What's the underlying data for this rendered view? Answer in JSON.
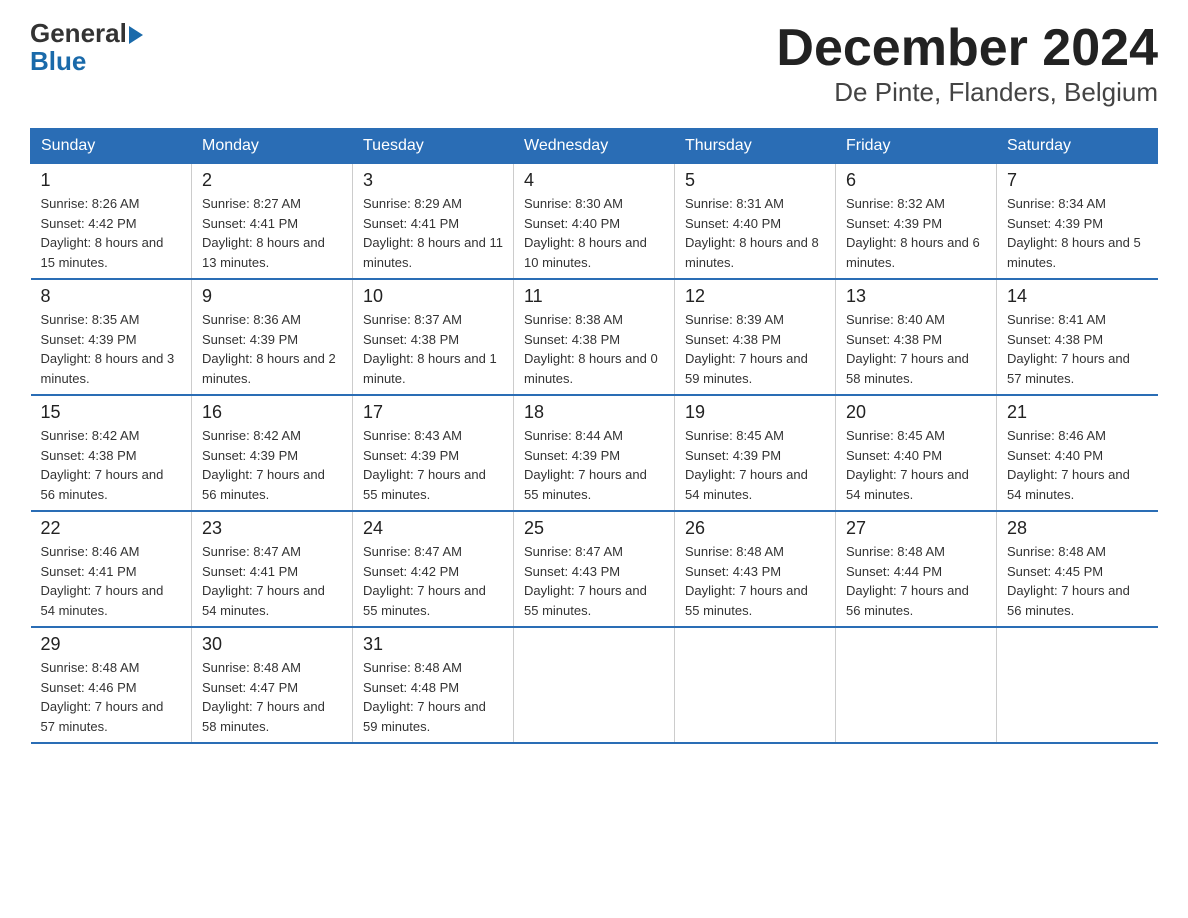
{
  "header": {
    "logo_line1": "General",
    "logo_line2": "Blue",
    "title": "December 2024",
    "subtitle": "De Pinte, Flanders, Belgium"
  },
  "columns": [
    "Sunday",
    "Monday",
    "Tuesday",
    "Wednesday",
    "Thursday",
    "Friday",
    "Saturday"
  ],
  "weeks": [
    [
      {
        "day": "1",
        "sunrise": "8:26 AM",
        "sunset": "4:42 PM",
        "daylight": "8 hours and 15 minutes."
      },
      {
        "day": "2",
        "sunrise": "8:27 AM",
        "sunset": "4:41 PM",
        "daylight": "8 hours and 13 minutes."
      },
      {
        "day": "3",
        "sunrise": "8:29 AM",
        "sunset": "4:41 PM",
        "daylight": "8 hours and 11 minutes."
      },
      {
        "day": "4",
        "sunrise": "8:30 AM",
        "sunset": "4:40 PM",
        "daylight": "8 hours and 10 minutes."
      },
      {
        "day": "5",
        "sunrise": "8:31 AM",
        "sunset": "4:40 PM",
        "daylight": "8 hours and 8 minutes."
      },
      {
        "day": "6",
        "sunrise": "8:32 AM",
        "sunset": "4:39 PM",
        "daylight": "8 hours and 6 minutes."
      },
      {
        "day": "7",
        "sunrise": "8:34 AM",
        "sunset": "4:39 PM",
        "daylight": "8 hours and 5 minutes."
      }
    ],
    [
      {
        "day": "8",
        "sunrise": "8:35 AM",
        "sunset": "4:39 PM",
        "daylight": "8 hours and 3 minutes."
      },
      {
        "day": "9",
        "sunrise": "8:36 AM",
        "sunset": "4:39 PM",
        "daylight": "8 hours and 2 minutes."
      },
      {
        "day": "10",
        "sunrise": "8:37 AM",
        "sunset": "4:38 PM",
        "daylight": "8 hours and 1 minute."
      },
      {
        "day": "11",
        "sunrise": "8:38 AM",
        "sunset": "4:38 PM",
        "daylight": "8 hours and 0 minutes."
      },
      {
        "day": "12",
        "sunrise": "8:39 AM",
        "sunset": "4:38 PM",
        "daylight": "7 hours and 59 minutes."
      },
      {
        "day": "13",
        "sunrise": "8:40 AM",
        "sunset": "4:38 PM",
        "daylight": "7 hours and 58 minutes."
      },
      {
        "day": "14",
        "sunrise": "8:41 AM",
        "sunset": "4:38 PM",
        "daylight": "7 hours and 57 minutes."
      }
    ],
    [
      {
        "day": "15",
        "sunrise": "8:42 AM",
        "sunset": "4:38 PM",
        "daylight": "7 hours and 56 minutes."
      },
      {
        "day": "16",
        "sunrise": "8:42 AM",
        "sunset": "4:39 PM",
        "daylight": "7 hours and 56 minutes."
      },
      {
        "day": "17",
        "sunrise": "8:43 AM",
        "sunset": "4:39 PM",
        "daylight": "7 hours and 55 minutes."
      },
      {
        "day": "18",
        "sunrise": "8:44 AM",
        "sunset": "4:39 PM",
        "daylight": "7 hours and 55 minutes."
      },
      {
        "day": "19",
        "sunrise": "8:45 AM",
        "sunset": "4:39 PM",
        "daylight": "7 hours and 54 minutes."
      },
      {
        "day": "20",
        "sunrise": "8:45 AM",
        "sunset": "4:40 PM",
        "daylight": "7 hours and 54 minutes."
      },
      {
        "day": "21",
        "sunrise": "8:46 AM",
        "sunset": "4:40 PM",
        "daylight": "7 hours and 54 minutes."
      }
    ],
    [
      {
        "day": "22",
        "sunrise": "8:46 AM",
        "sunset": "4:41 PM",
        "daylight": "7 hours and 54 minutes."
      },
      {
        "day": "23",
        "sunrise": "8:47 AM",
        "sunset": "4:41 PM",
        "daylight": "7 hours and 54 minutes."
      },
      {
        "day": "24",
        "sunrise": "8:47 AM",
        "sunset": "4:42 PM",
        "daylight": "7 hours and 55 minutes."
      },
      {
        "day": "25",
        "sunrise": "8:47 AM",
        "sunset": "4:43 PM",
        "daylight": "7 hours and 55 minutes."
      },
      {
        "day": "26",
        "sunrise": "8:48 AM",
        "sunset": "4:43 PM",
        "daylight": "7 hours and 55 minutes."
      },
      {
        "day": "27",
        "sunrise": "8:48 AM",
        "sunset": "4:44 PM",
        "daylight": "7 hours and 56 minutes."
      },
      {
        "day": "28",
        "sunrise": "8:48 AM",
        "sunset": "4:45 PM",
        "daylight": "7 hours and 56 minutes."
      }
    ],
    [
      {
        "day": "29",
        "sunrise": "8:48 AM",
        "sunset": "4:46 PM",
        "daylight": "7 hours and 57 minutes."
      },
      {
        "day": "30",
        "sunrise": "8:48 AM",
        "sunset": "4:47 PM",
        "daylight": "7 hours and 58 minutes."
      },
      {
        "day": "31",
        "sunrise": "8:48 AM",
        "sunset": "4:48 PM",
        "daylight": "7 hours and 59 minutes."
      },
      null,
      null,
      null,
      null
    ]
  ]
}
